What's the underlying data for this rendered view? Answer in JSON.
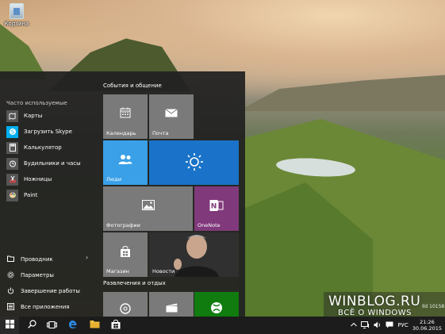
{
  "desktop": {
    "recycle_bin_label": "Корзина"
  },
  "start_menu": {
    "most_used_heading": "Часто используемые",
    "apps": [
      {
        "label": "Карты",
        "icon": "map-icon",
        "color": "#555555"
      },
      {
        "label": "Загрузить Skype",
        "icon": "skype-icon",
        "color": "#00aff0"
      },
      {
        "label": "Калькулятор",
        "icon": "calculator-icon",
        "color": "#555555"
      },
      {
        "label": "Будильники и часы",
        "icon": "alarm-clock-icon",
        "color": "#555555"
      },
      {
        "label": "Ножницы",
        "icon": "scissors-icon",
        "color": "#555555"
      },
      {
        "label": "Paint",
        "icon": "paint-icon",
        "color": "#555555"
      }
    ],
    "bottom": {
      "explorer": "Проводник",
      "settings": "Параметры",
      "power": "Завершение работы",
      "all_apps": "Все приложения"
    },
    "groups": {
      "events_title": "События и общение",
      "entertainment_title": "Развлечения и отдых"
    },
    "tiles": {
      "calendar": "Календарь",
      "mail": "Почта",
      "people": "Люди",
      "photos": "Фотографии",
      "onenote": "OneNote",
      "store": "Магазин",
      "news": "Новости"
    },
    "colors": {
      "gray_tile": "#7a7a7a",
      "people_tile": "#3aa0e8",
      "weather_tile": "#1a73c8",
      "onenote_tile": "#80397b",
      "xbox_tile": "#107c10",
      "news_tile": "#2a2a2a"
    }
  },
  "taskbar": {
    "language": "РУС",
    "time": "21:26",
    "date": "30.06.2015"
  },
  "watermark": {
    "line1": "WINBLOG.RU",
    "line2": "ВСЁ О WINDOWS",
    "build": "Ild 10158"
  }
}
